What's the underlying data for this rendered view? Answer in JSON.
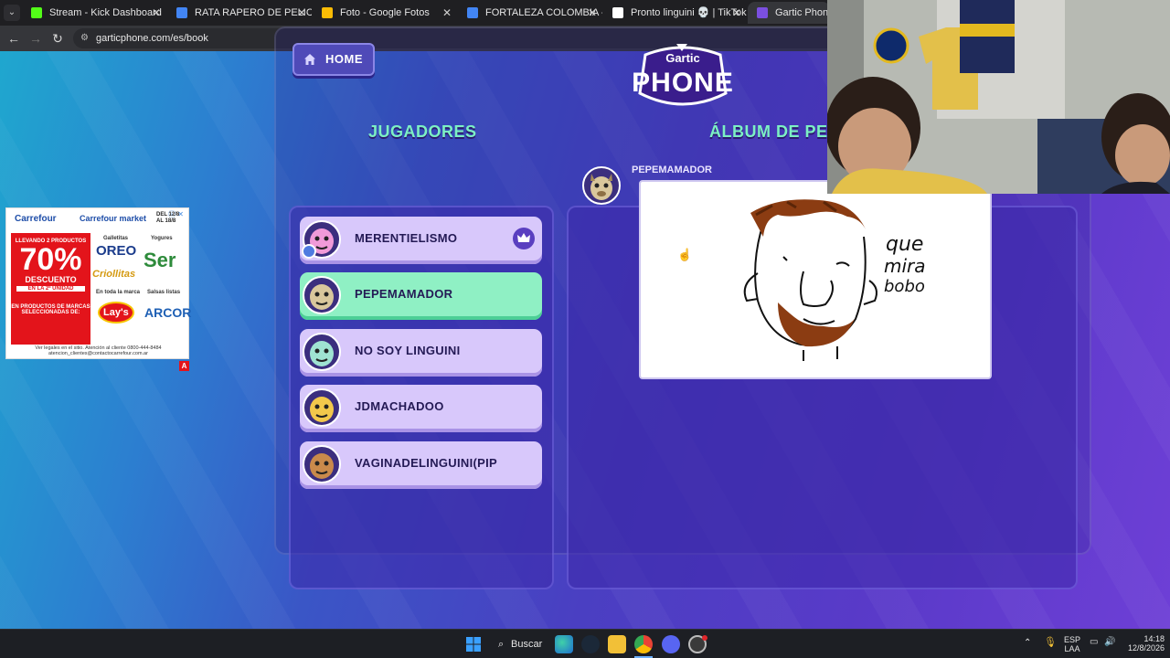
{
  "browser": {
    "tabs": [
      {
        "title": "Stream - Kick Dashboard",
        "icon": "kick-icon",
        "color": "#53fc18"
      },
      {
        "title": "RATA RAPERO DE PELICULA DE",
        "icon": "google-icon",
        "color": "#4285f4"
      },
      {
        "title": "Foto - Google Fotos",
        "icon": "google-photos-icon",
        "color": "#fbbc05"
      },
      {
        "title": "FORTALEZA COLOMBIA - Buscar",
        "icon": "google-icon",
        "color": "#4285f4"
      },
      {
        "title": "Pronto linguini 💀 | TikTok",
        "icon": "tiktok-icon",
        "color": "#ffffff"
      },
      {
        "title": "Gartic Phone - Tele",
        "icon": "gartic-icon",
        "color": "#7b4fe0"
      }
    ],
    "url": "garticphone.com/es/book"
  },
  "page": {
    "home_label": "HOME",
    "logo_top": "Gartic",
    "logo_bottom": "PHONE",
    "players_title": "JUGADORES",
    "album_title": "ÁLBUM DE PEPEMAMADOR",
    "players": [
      {
        "name": "MERENTIELISMO",
        "host": true,
        "active": false,
        "avatar": "pink-helmet-avatar"
      },
      {
        "name": "PEPEMAMADOR",
        "host": false,
        "active": true,
        "avatar": "llama-avatar"
      },
      {
        "name": "NO SOY LINGUINI",
        "host": false,
        "active": false,
        "avatar": "ghost-avatar"
      },
      {
        "name": "JDMACHADOO",
        "host": false,
        "active": false,
        "avatar": "pizza-avatar"
      },
      {
        "name": "VAGINADELINGUINI(PIP",
        "host": false,
        "active": false,
        "avatar": "mustache-avatar"
      }
    ],
    "album": {
      "author": "PEPEMAMADOR",
      "drawing_text": [
        "que",
        "mira",
        "bobo"
      ]
    }
  },
  "ad": {
    "brand1": "Carrefour",
    "brand2": "Carrefour market",
    "dates": "DEL 12/8 AL 18/8",
    "promo_line1": "LLEVANDO 2 PRODUCTOS",
    "promo_big": "70%",
    "promo_line2": "DESCUENTO",
    "promo_line3": "EN LA 2ª UNIDAD",
    "promo_line4": "EN PRODUCTOS DE MARCAS SELECCIONADAS DE:",
    "cat1": "Galletitas",
    "cat2": "Yogures",
    "cat3": "En toda la marca",
    "cat4": "Salsas listas",
    "prod1": "OREO",
    "prod2": "Ser",
    "prod3": "Criollitas",
    "prod4": "Lay's",
    "prod5": "ARCOR",
    "footer": "Ver legales en el sitio. Atención al cliente 0800-444-8484 atencion_clientes@contactocarrefour.com.ar"
  },
  "taskbar": {
    "search": "Buscar",
    "lang1": "ESP",
    "lang2": "LAA",
    "time": "14:18",
    "date": "12/8/2026"
  }
}
